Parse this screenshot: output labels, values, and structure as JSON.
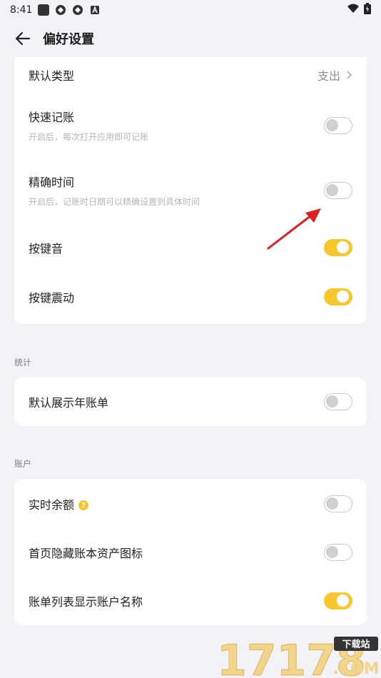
{
  "status": {
    "time": "8:41"
  },
  "header": {
    "title": "偏好设置"
  },
  "general": {
    "default_type": {
      "label": "默认类型",
      "value": "支出"
    },
    "quick_entry": {
      "label": "快速记账",
      "sub": "开启后，每次打开应用即可记账",
      "on": false
    },
    "precise_time": {
      "label": "精确时间",
      "sub": "开启后，记账时日期可以精确设置到具体时间",
      "on": false
    },
    "key_sound": {
      "label": "按键音",
      "on": true
    },
    "key_vibrate": {
      "label": "按键震动",
      "on": true
    }
  },
  "stats": {
    "section": "统计",
    "year_bill": {
      "label": "默认展示年账单",
      "on": false
    }
  },
  "account": {
    "section": "账户",
    "realtime_balance": {
      "label": "实时余额",
      "on": false
    },
    "hide_asset_icon": {
      "label": "首页隐藏账本资产图标",
      "on": false
    },
    "show_account_name": {
      "label": "账单列表显示账户名称",
      "on": true
    }
  },
  "colors": {
    "accent": "#f6c82e",
    "background": "#f3f3f7"
  },
  "watermark": {
    "text": "17178",
    "badge": "下载站",
    "suffix": ".COM"
  }
}
